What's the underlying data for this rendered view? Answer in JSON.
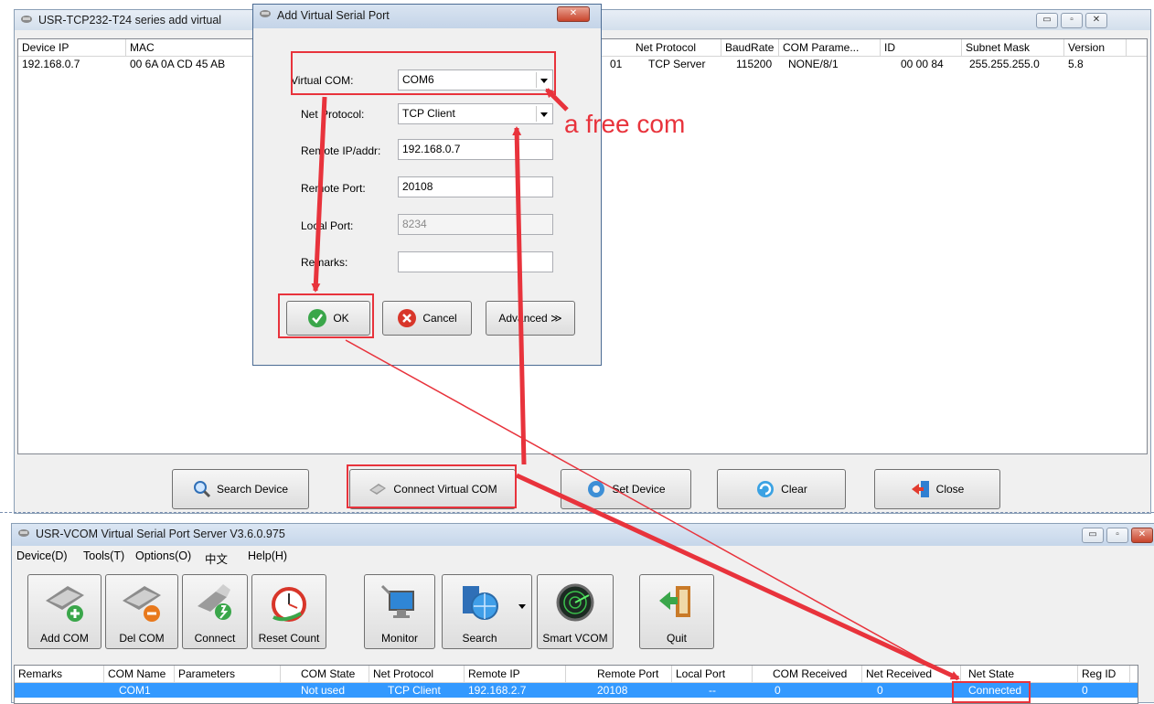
{
  "main_window": {
    "title": "USR-TCP232-T24 series add virtual",
    "columns": [
      "Device IP",
      "MAC",
      "Net Protocol",
      "BaudRate",
      "COM Parame...",
      "ID",
      "Subnet Mask",
      "Version"
    ],
    "row": {
      "device_ip": "192.168.0.7",
      "mac": "00 6A 0A CD 45 AB",
      "partial": "01",
      "net_protocol": "TCP Server",
      "baudrate": "115200",
      "com_params": "NONE/8/1",
      "id": "00 00 84",
      "subnet_mask": "255.255.255.0",
      "version": "5.8"
    },
    "buttons": {
      "search_device": "Search Device",
      "connect_virtual_com": "Connect Virtual COM",
      "set_device": "Set Device",
      "clear": "Clear",
      "close": "Close"
    }
  },
  "dialog": {
    "title": "Add Virtual Serial Port",
    "virtual_com_label": "Virtual COM:",
    "virtual_com_value": "COM6",
    "net_protocol_label": "Net Protocol:",
    "net_protocol_value": "TCP Client",
    "remote_ip_label": "Remote IP/addr:",
    "remote_ip_value": "192.168.0.7",
    "remote_port_label": "Remote Port:",
    "remote_port_value": "20108",
    "local_port_label": "Local Port:",
    "local_port_value": "8234",
    "remarks_label": "Remarks:",
    "remarks_value": "",
    "ok_label": "OK",
    "cancel_label": "Cancel",
    "advanced_label": "Advanced ≫"
  },
  "annotation": {
    "text": "a free com"
  },
  "vcom_window": {
    "title": "USR-VCOM Virtual Serial Port Server V3.6.0.975",
    "menu": [
      "Device(D)",
      "Tools(T)",
      "Options(O)",
      "中文",
      "Help(H)"
    ],
    "toolbar": [
      "Add COM",
      "Del COM",
      "Connect",
      "Reset Count",
      "Monitor",
      "Search",
      "Smart VCOM",
      "Quit"
    ],
    "columns": [
      "Remarks",
      "COM Name",
      "Parameters",
      "COM State",
      "Net Protocol",
      "Remote IP",
      "Remote Port",
      "Local Port",
      "COM Received",
      "Net Received",
      "Net State",
      "Reg ID"
    ],
    "row": {
      "remarks": "",
      "com_name": "COM1",
      "parameters": "",
      "com_state": "Not used",
      "net_protocol": "TCP Client",
      "remote_ip": "192.168.2.7",
      "remote_port": "20108",
      "local_port": "--",
      "com_received": "0",
      "net_received": "0",
      "net_state": "Connected",
      "reg_id": "0"
    }
  },
  "colors": {
    "highlight": "#e8333c",
    "selection": "#3399ff"
  }
}
